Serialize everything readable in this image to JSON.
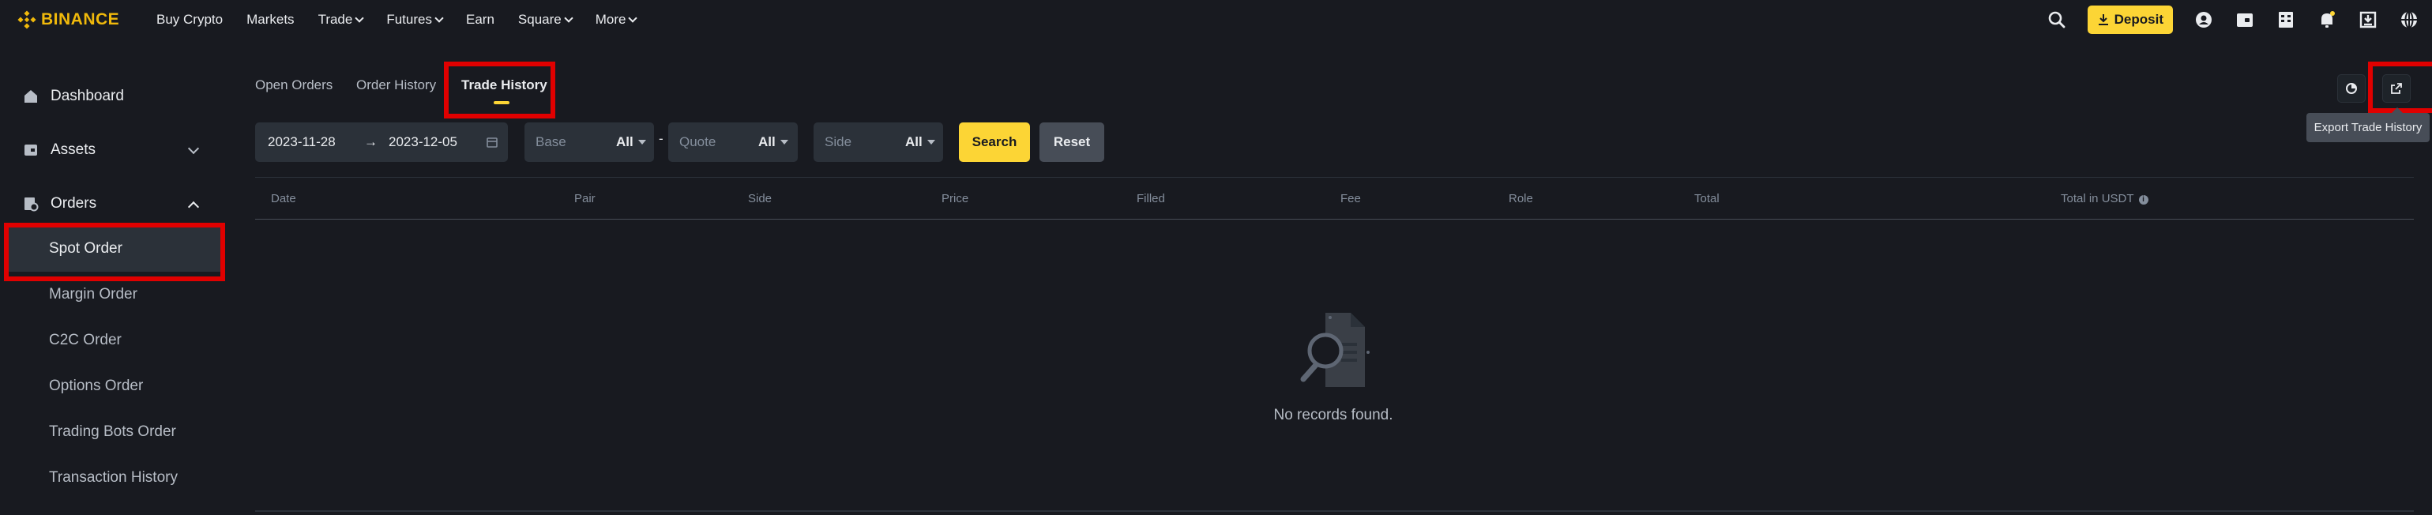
{
  "brand": {
    "name": "BINANCE",
    "color": "#f0b90b"
  },
  "nav": {
    "items": [
      {
        "label": "Buy Crypto",
        "dropdown": false
      },
      {
        "label": "Markets",
        "dropdown": false
      },
      {
        "label": "Trade",
        "dropdown": true
      },
      {
        "label": "Futures",
        "dropdown": true
      },
      {
        "label": "Earn",
        "dropdown": false
      },
      {
        "label": "Square",
        "dropdown": true
      },
      {
        "label": "More",
        "dropdown": true
      }
    ],
    "deposit_label": "Deposit",
    "icons": [
      "search-icon",
      "user-icon",
      "wallet-icon",
      "orders-icon",
      "notification-icon",
      "download-icon",
      "globe-icon"
    ]
  },
  "sidebar": {
    "dashboard": "Dashboard",
    "assets": "Assets",
    "orders": "Orders",
    "sub_items": [
      "Spot Order",
      "Margin Order",
      "C2C Order",
      "Options Order",
      "Trading Bots Order",
      "Transaction History"
    ],
    "active": "Spot Order"
  },
  "tabs": {
    "items": [
      "Open Orders",
      "Order History",
      "Trade History"
    ],
    "active": "Trade History"
  },
  "filters": {
    "date_from": "2023-11-28",
    "date_to": "2023-12-05",
    "base_placeholder": "Base",
    "base_value": "All",
    "dash": "-",
    "quote_placeholder": "Quote",
    "quote_value": "All",
    "side_placeholder": "Side",
    "side_value": "All",
    "search_label": "Search",
    "reset_label": "Reset"
  },
  "table": {
    "columns": [
      "Date",
      "Pair",
      "Side",
      "Price",
      "Filled",
      "Fee",
      "Role",
      "Total",
      "Total in USDT"
    ],
    "rows": []
  },
  "empty_state": {
    "message": "No records found."
  },
  "tooltip": {
    "text": "Export Trade History"
  },
  "colors": {
    "accent": "#fcd535",
    "background": "#181a20",
    "panel": "#2b3139",
    "highlight": "#e00000"
  }
}
